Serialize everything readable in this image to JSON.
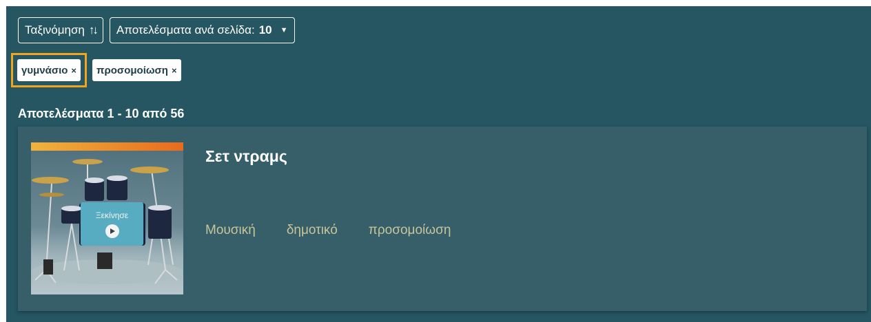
{
  "controls": {
    "sort_label": "Ταξινόμηση",
    "sort_icon": "sort-arrows-icon",
    "per_page_label": "Αποτελέσματα ανά σελίδα:",
    "per_page_value": "10"
  },
  "active_filters": [
    {
      "label": "γυμνάσιο",
      "remove": "×",
      "focused": true
    },
    {
      "label": "προσομοίωση",
      "remove": "×",
      "focused": false
    }
  ],
  "results_summary": "Αποτελέσματα 1 - 10 από 56",
  "results": [
    {
      "title": "Σετ ντραμς",
      "start_label": "Ξεκίνησε",
      "tags": [
        "Μουσική",
        "δημοτικό",
        "προσομοίωση"
      ]
    }
  ],
  "colors": {
    "panel_bg": "#255662",
    "card_bg": "#365f69",
    "focus_outline": "#f0a51c",
    "tag_text": "#c7c59a",
    "start_overlay": "#5ab3c9"
  }
}
